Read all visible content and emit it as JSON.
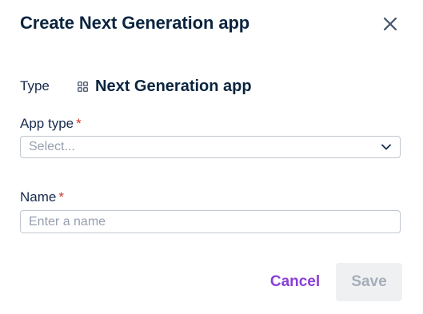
{
  "dialog": {
    "title": "Create Next Generation app",
    "close_icon": "close-icon"
  },
  "type": {
    "label": "Type",
    "icon": "grid-icon",
    "value": "Next Generation app"
  },
  "app_type": {
    "label": "App type",
    "required_marker": "*",
    "placeholder": "Select...",
    "dropdown_icon": "chevron-down-icon"
  },
  "name": {
    "label": "Name",
    "required_marker": "*",
    "placeholder": "Enter a name",
    "value": ""
  },
  "actions": {
    "cancel_label": "Cancel",
    "save_label": "Save"
  },
  "colors": {
    "title": "#0b2540",
    "required": "#c9372c",
    "cancel": "#8a3fd6",
    "save_disabled_text": "#a5adba",
    "save_disabled_bg": "#eff0f2",
    "border": "#c1c7d0",
    "placeholder": "#97a0af"
  }
}
